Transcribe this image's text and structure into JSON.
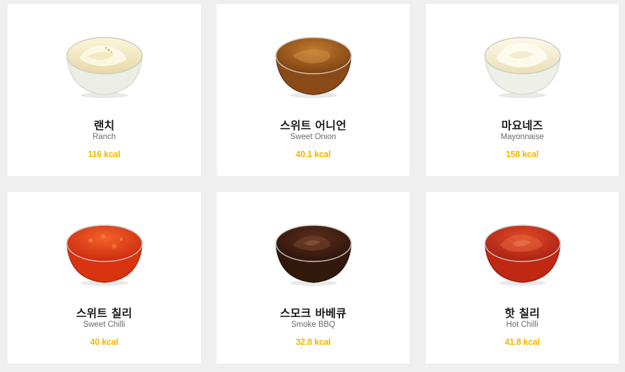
{
  "sauces": [
    {
      "name_ko": "랜치",
      "name_en": "Ranch",
      "kcal": "116 kcal",
      "color": "#f2e9c6",
      "icon": "ranch-sauce-bowl-icon"
    },
    {
      "name_ko": "스위트 어니언",
      "name_en": "Sweet Onion",
      "kcal": "40.1 kcal",
      "color": "#9a5a1a",
      "icon": "sweet-onion-sauce-bowl-icon"
    },
    {
      "name_ko": "마요네즈",
      "name_en": "Mayonnaise",
      "kcal": "158 kcal",
      "color": "#f3ecd3",
      "icon": "mayonnaise-sauce-bowl-icon"
    },
    {
      "name_ko": "스위트 칠리",
      "name_en": "Sweet Chilli",
      "kcal": "40 kcal",
      "color": "#e23c12",
      "icon": "sweet-chilli-sauce-bowl-icon"
    },
    {
      "name_ko": "스모크 바베큐",
      "name_en": "Smoke BBQ",
      "kcal": "32.8 kcal",
      "color": "#3a1d12",
      "icon": "smoke-bbq-sauce-bowl-icon"
    },
    {
      "name_ko": "핫 칠리",
      "name_en": "Hot Chilli",
      "kcal": "41.8 kcal",
      "color": "#cc2a14",
      "icon": "hot-chilli-sauce-bowl-icon"
    }
  ],
  "colors": {
    "background": "#efefef",
    "card": "#ffffff",
    "kcal_accent": "#f6b500"
  }
}
